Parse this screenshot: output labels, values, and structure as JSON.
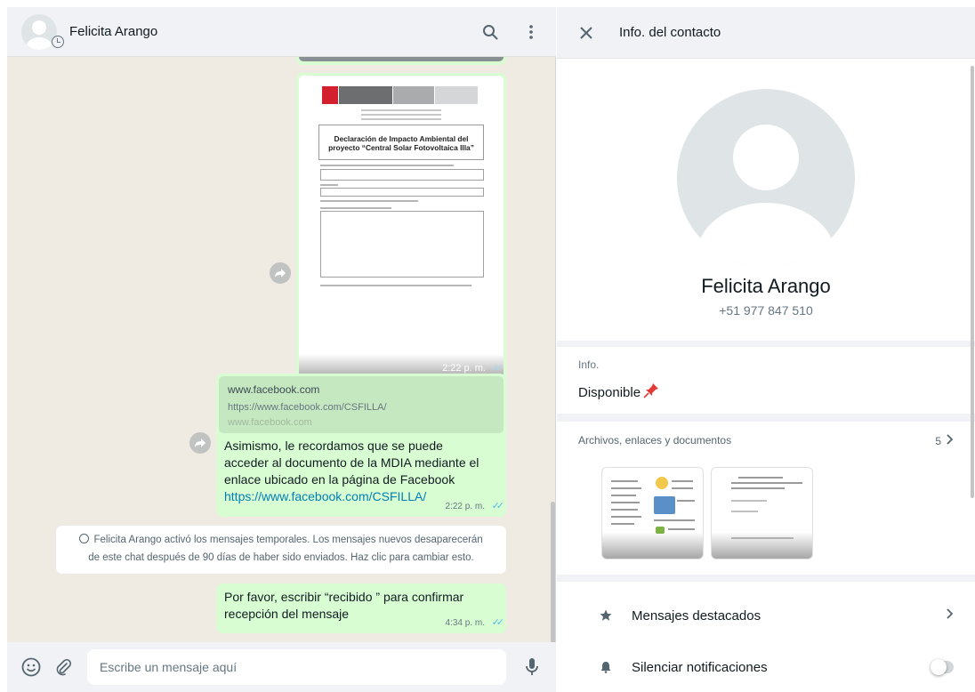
{
  "chat": {
    "contact_name": "Felicita Arango",
    "compose_placeholder": "Escribe un mensaje aquí",
    "document_message": {
      "title_line1": "Declaración de Impacto Ambiental del",
      "title_line2": "proyecto “Central Solar Fotovoltaica Illa”",
      "time": "2:22 p. m."
    },
    "link_message": {
      "preview_host": "www.facebook.com",
      "preview_url": "https://www.facebook.com/CSFILLA/",
      "preview_host2": "www.facebook.com",
      "text": "Asimismo, le recordamos que se puede acceder al documento de la MDIA mediante el enlace ubicado en la página de Facebook",
      "link": "https://www.facebook.com/CSFILLA/",
      "time": "2:22 p. m."
    },
    "system_message": {
      "line1": "Felicita Arango activó los mensajes temporales. Los mensajes nuevos desaparecerán",
      "line2": "de este chat después de 90 días de haber sido enviados. Haz clic para cambiar esto."
    },
    "last_message": {
      "text": "Por favor, escribir “recibido ” para confirmar recepción del mensaje",
      "time": "4:34 p. m."
    }
  },
  "info_panel": {
    "header_title": "Info. del contacto",
    "name": "Felicita Arango",
    "phone": "+51 977 847 510",
    "about_label": "Info.",
    "about_value": "Disponible",
    "media_label": "Archivos, enlaces y documentos",
    "media_count": "5",
    "starred_label": "Mensajes destacados",
    "mute_label": "Silenciar notificaciones",
    "mute_on": false
  },
  "icons": {
    "search": "search-icon",
    "menu": "menu-icon",
    "close": "close-icon",
    "emoji": "emoji-icon",
    "attach": "attach-icon",
    "mic": "mic-icon",
    "star": "star-icon",
    "bell": "bell-icon",
    "pin": "pushpin-icon"
  },
  "colors": {
    "outgoing_bubble": "#d9fdd3",
    "chat_background": "#efeae2",
    "link": "#027eb5",
    "read_check": "#53bdeb",
    "panel_header": "#f0f2f5"
  }
}
